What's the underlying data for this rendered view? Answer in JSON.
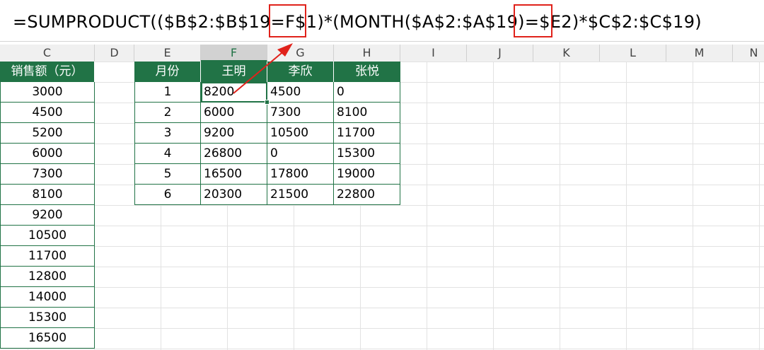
{
  "formula_bar": {
    "segments": [
      "=SUMPRODUCT(($B$2:$B$19=",
      "F$1",
      ")*(MONTH($A$2:$A$19)=",
      "$E2",
      ")*$C$2:$C$19)"
    ]
  },
  "column_headers": [
    "C",
    "D",
    "E",
    "F",
    "G",
    "H",
    "I",
    "J",
    "K",
    "L",
    "M",
    "N"
  ],
  "sales_column": {
    "header": "销售额（元）",
    "values": [
      "3000",
      "4500",
      "5200",
      "6000",
      "7300",
      "8100",
      "9200",
      "10500",
      "11700",
      "12800",
      "14000",
      "15300",
      "16500"
    ]
  },
  "summary_table": {
    "headers": [
      "月份",
      "王明",
      "李欣",
      "张悦"
    ],
    "rows": [
      [
        "1",
        "8200",
        "4500",
        "0"
      ],
      [
        "2",
        "6000",
        "7300",
        "8100"
      ],
      [
        "3",
        "9200",
        "10500",
        "11700"
      ],
      [
        "4",
        "26800",
        "0",
        "15300"
      ],
      [
        "5",
        "16500",
        "17800",
        "19000"
      ],
      [
        "6",
        "20300",
        "21500",
        "22800"
      ]
    ]
  },
  "colors": {
    "header_green": "#217346",
    "highlight_red": "#e0221b"
  }
}
